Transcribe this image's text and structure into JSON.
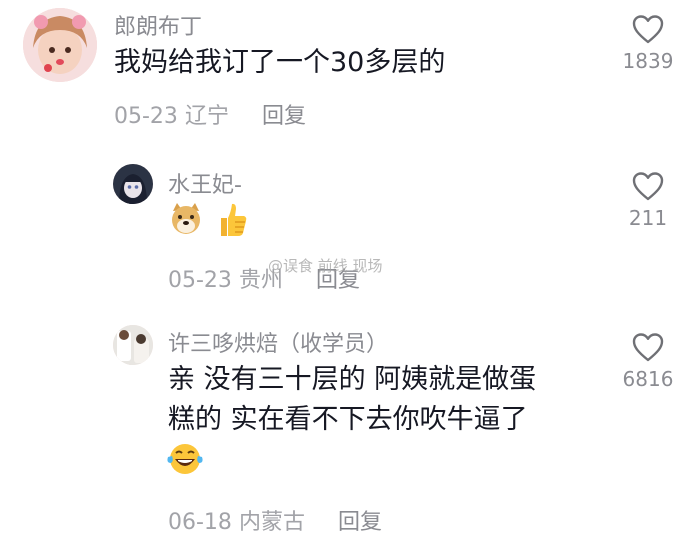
{
  "comments": [
    {
      "username": "郎朗布丁",
      "text": "我妈给我订了一个30多层的",
      "date": "05-23",
      "location": "辽宁",
      "reply_label": "回复",
      "like_count": "1839",
      "avatar": "avatar-girl-pink"
    },
    {
      "username": "水王妃-",
      "text": "",
      "emojis": [
        "doge-emoji",
        "thumbs-up-emoji"
      ],
      "date": "05-23",
      "location": "贵州",
      "reply_label": "回复",
      "like_count": "211",
      "avatar": "avatar-anime-dark"
    },
    {
      "username": "许三哆烘焙（收学员）",
      "text_line1": "亲 没有三十层的 阿姨就是做蛋",
      "text_line2": "糕的 实在看不下去你吹牛逼了",
      "emojis": [
        "laughing-tears-emoji"
      ],
      "date": "06-18",
      "location": "内蒙古",
      "reply_label": "回复",
      "like_count": "6816",
      "avatar": "avatar-baker"
    }
  ],
  "watermark": "@误食 前线 现场"
}
